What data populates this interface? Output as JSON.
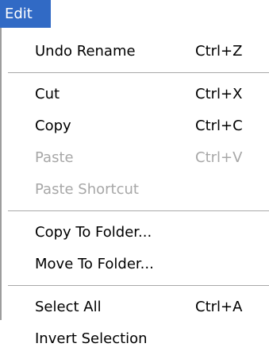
{
  "menu": {
    "title": "Edit",
    "colors": {
      "highlight": "#316ac5",
      "disabled_text": "#a7a7a7",
      "separator": "#a9a9a9"
    }
  },
  "items": {
    "undo": {
      "label": "Undo Rename",
      "shortcut": "Ctrl+Z"
    },
    "cut": {
      "label": "Cut",
      "shortcut": "Ctrl+X"
    },
    "copy": {
      "label": "Copy",
      "shortcut": "Ctrl+C"
    },
    "paste": {
      "label": "Paste",
      "shortcut": "Ctrl+V",
      "disabled": true
    },
    "paste_shortcut": {
      "label": "Paste Shortcut",
      "disabled": true
    },
    "copy_to_folder": {
      "label": "Copy To Folder..."
    },
    "move_to_folder": {
      "label": "Move To Folder..."
    },
    "select_all": {
      "label": "Select All",
      "shortcut": "Ctrl+A"
    },
    "invert_selection": {
      "label": "Invert Selection"
    }
  }
}
